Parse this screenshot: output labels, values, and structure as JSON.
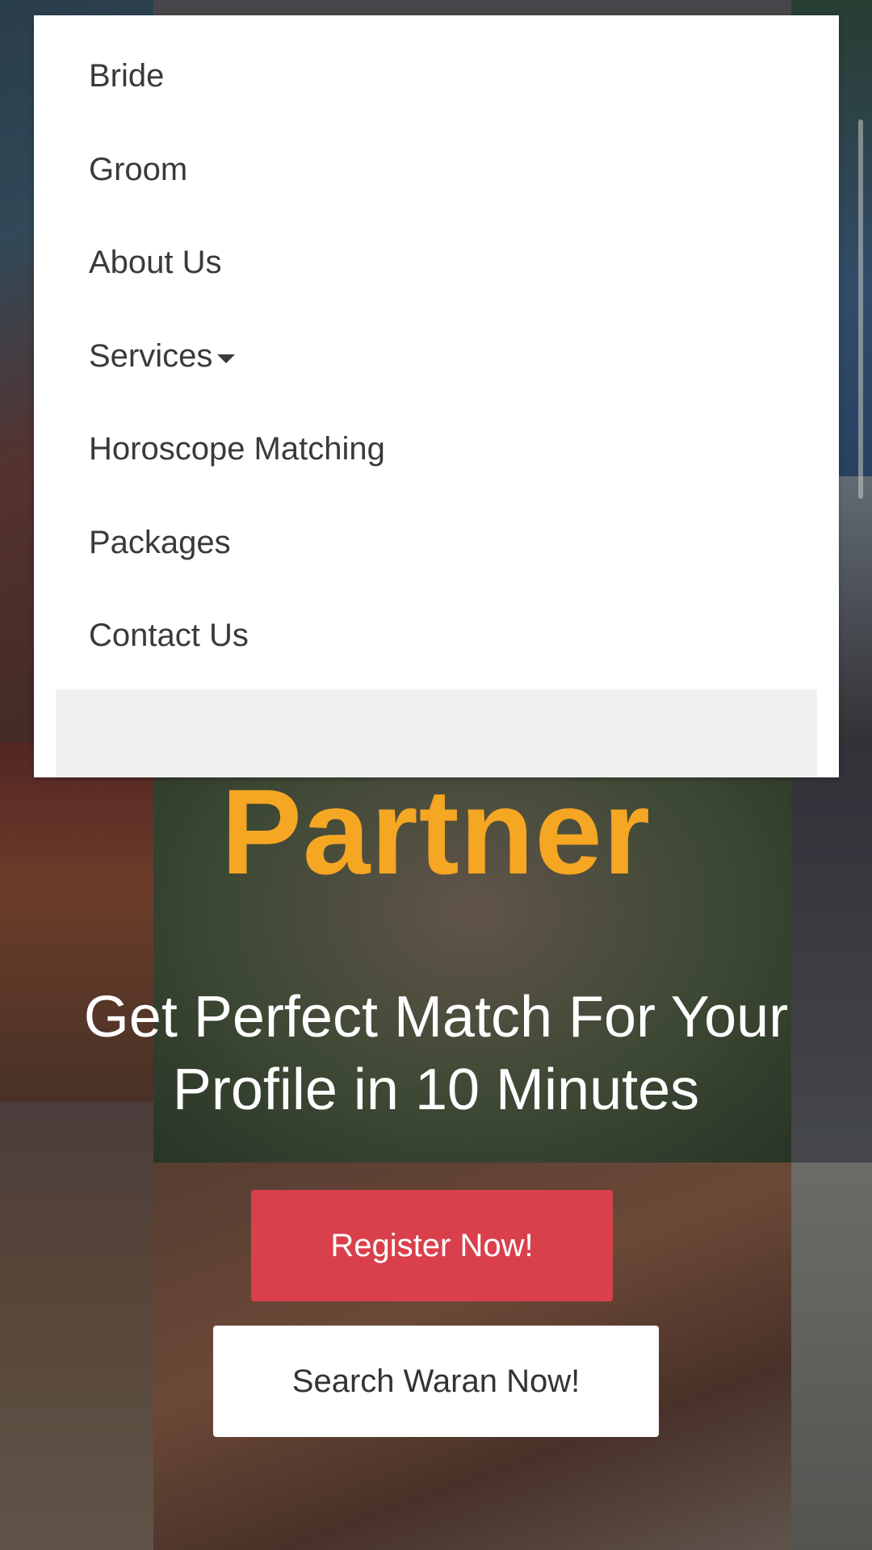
{
  "menu": {
    "items": [
      {
        "label": "Bride"
      },
      {
        "label": "Groom"
      },
      {
        "label": "About Us"
      },
      {
        "label": "Services",
        "has_dropdown": true
      },
      {
        "label": "Horoscope Matching"
      },
      {
        "label": "Packages"
      },
      {
        "label": "Contact Us"
      }
    ]
  },
  "hero": {
    "title": "Partner",
    "subtitle": "Get Perfect Match For Your Profile in 10 Minutes",
    "register_label": "Register Now!",
    "search_label": "Search Waran Now!"
  },
  "colors": {
    "accent": "#f5a623",
    "register_button": "#d9404c",
    "search_button": "#ffffff"
  },
  "icons": {
    "services_caret": "caret-down-icon"
  }
}
